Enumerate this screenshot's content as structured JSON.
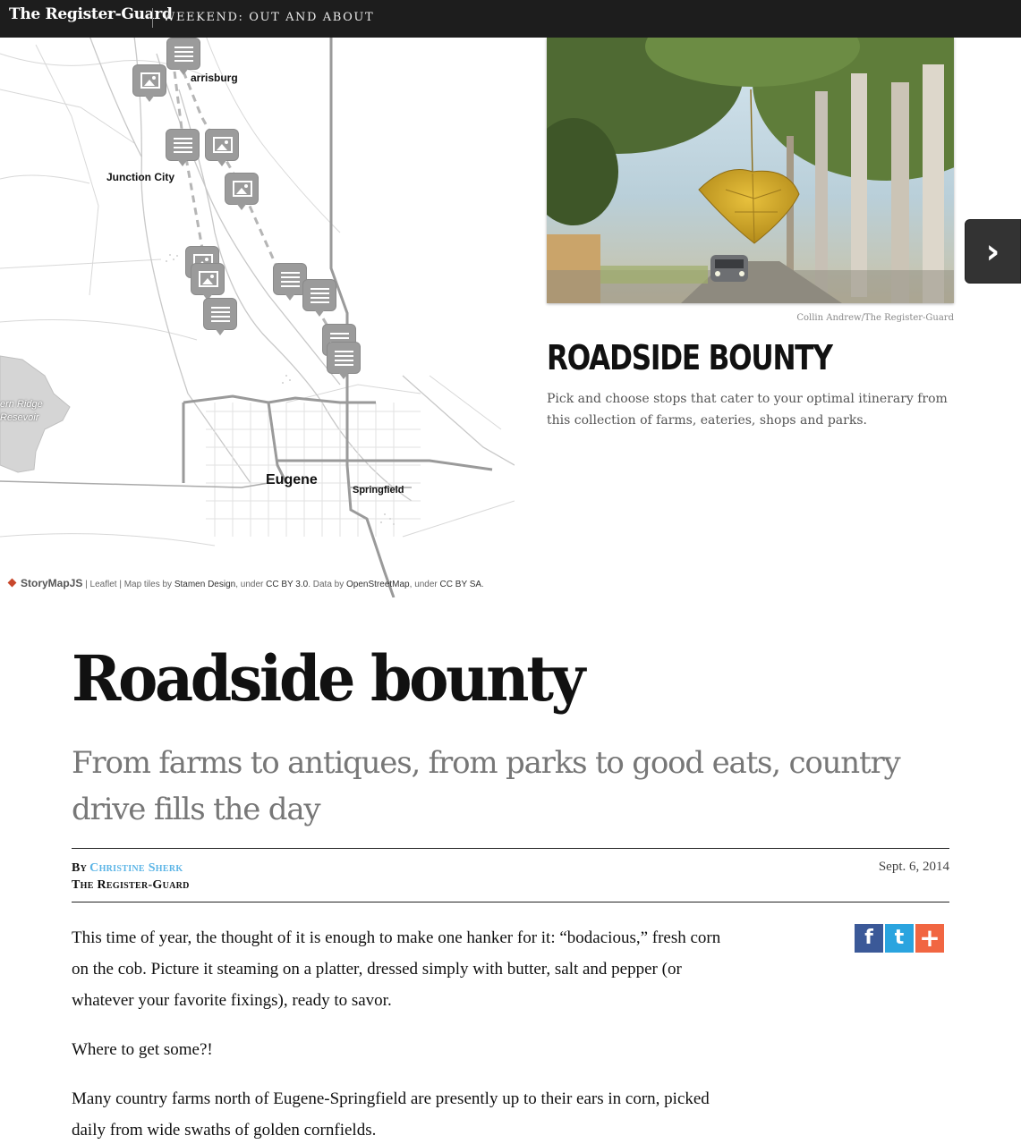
{
  "topbar": {
    "brand": "The Register-Guard",
    "section": "WEEKEND: OUT AND ABOUT"
  },
  "map": {
    "labels": {
      "harrisburg": "arrisburg",
      "junction_city": "Junction City",
      "eugene": "Eugene",
      "springfield": "Springfield",
      "fern_ridge_1": "ern Ridge",
      "fern_ridge_2": "Resevoir"
    },
    "attribution": {
      "brand": "StoryMapJS",
      "leaflet": "Leaflet",
      "tiles_prefix": "Map tiles by",
      "tiles_by": "Stamen Design",
      "under1": "under",
      "license1": "CC BY 3.0",
      "data_prefix": "Data by",
      "data_by": "OpenStreetMap",
      "under2": "under",
      "license2": "CC BY SA"
    }
  },
  "slide": {
    "credit": "Collin Andrew/The Register-Guard",
    "title": "ROADSIDE BOUNTY",
    "text": "Pick and choose stops that cater to your optimal itinerary from this collection of farms, eateries, shops and parks.",
    "next_icon": "chevron-right-icon"
  },
  "article": {
    "headline": "Roadside bounty",
    "subhead": "From farms to antiques, from parks to good eats, country drive fills the day",
    "byline_by": "By",
    "author": "Christine Sherk",
    "outlet": "The Register-Guard",
    "date": "Sept. 6, 2014",
    "share": {
      "facebook": "f",
      "twitter": "t",
      "more": "+"
    },
    "paragraphs": [
      "This time of year, the thought of it is enough to make one hanker for it: “bodacious,” fresh corn on the cob. Picture it steaming on a platter, dressed simply with butter, salt and pepper (or whatever your favorite fixings), ready to savor.",
      "Where to get some?!",
      "Many country farms north of Eugene-Springfield are presently up to their ears in corn, picked daily from wide swaths of golden cornfields."
    ]
  },
  "colors": {
    "topbar_bg": "#1d1d1d",
    "author_link": "#5ab4e6",
    "facebook": "#3b5998",
    "twitter": "#2aa4df",
    "share_more": "#f16642",
    "map_marker": "#9b9b9b"
  }
}
